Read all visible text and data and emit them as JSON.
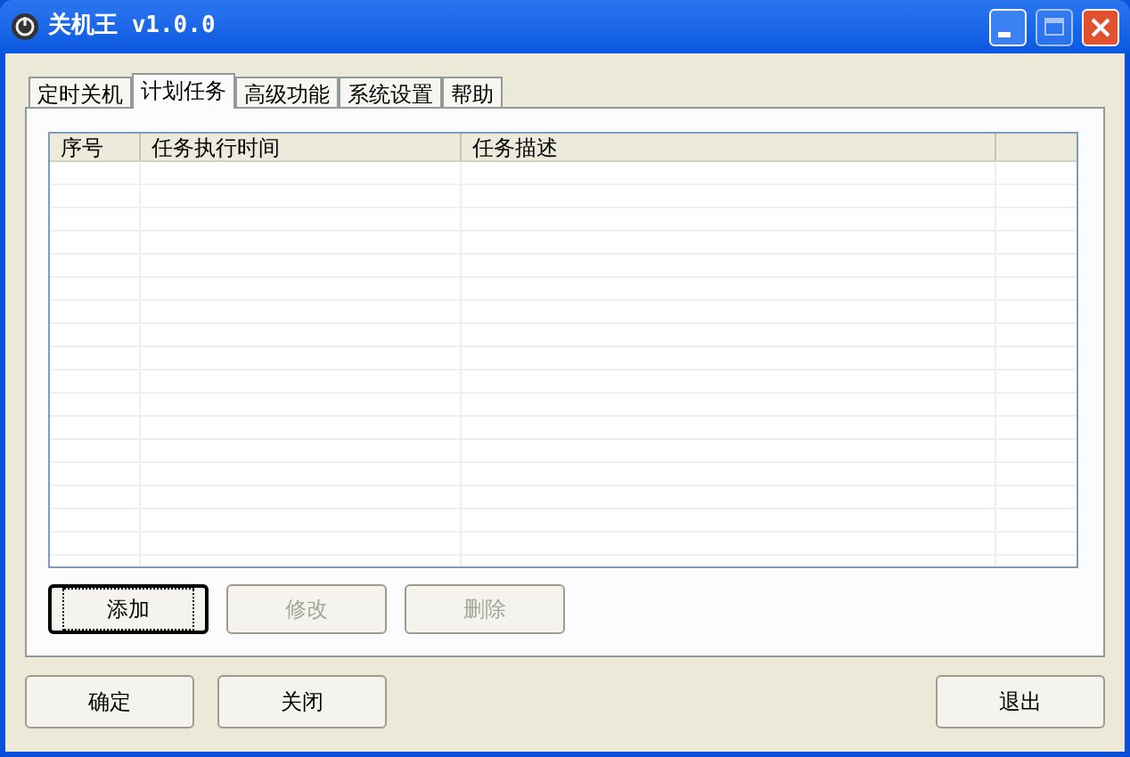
{
  "window": {
    "title": "关机王 v1.0.0"
  },
  "tabs": [
    {
      "label": "定时关机",
      "selected": false
    },
    {
      "label": "计划任务",
      "selected": true
    },
    {
      "label": "高级功能",
      "selected": false
    },
    {
      "label": "系统设置",
      "selected": false
    },
    {
      "label": "帮助",
      "selected": false
    }
  ],
  "table": {
    "columns": [
      "序号",
      "任务执行时间",
      "任务描述"
    ]
  },
  "task_buttons": [
    {
      "label": "添加",
      "disabled": false,
      "focused": true
    },
    {
      "label": "修改",
      "disabled": true,
      "focused": false
    },
    {
      "label": "删除",
      "disabled": true,
      "focused": false
    }
  ],
  "footer_buttons": [
    {
      "label": "确定"
    },
    {
      "label": "关闭"
    },
    {
      "label": "退出"
    }
  ]
}
